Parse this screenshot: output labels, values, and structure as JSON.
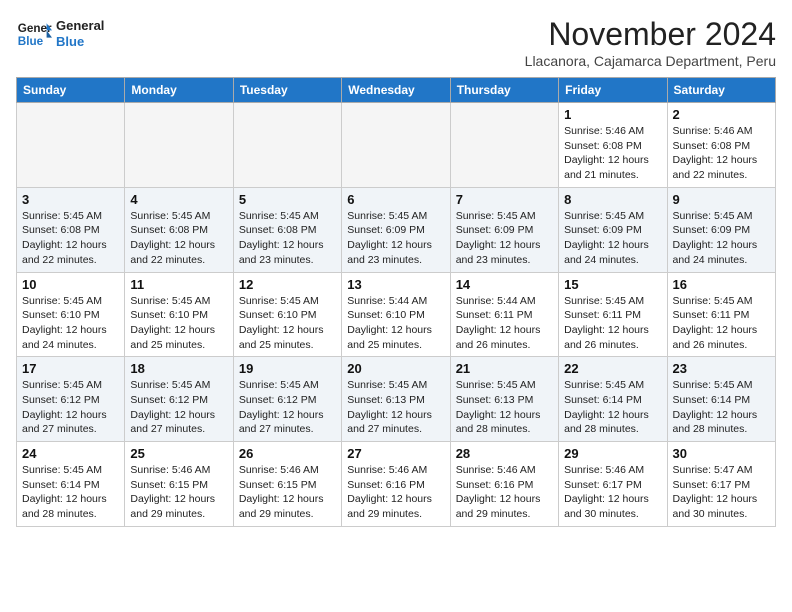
{
  "header": {
    "logo_line1": "General",
    "logo_line2": "Blue",
    "month": "November 2024",
    "location": "Llacanora, Cajamarca Department, Peru"
  },
  "weekdays": [
    "Sunday",
    "Monday",
    "Tuesday",
    "Wednesday",
    "Thursday",
    "Friday",
    "Saturday"
  ],
  "weeks": [
    [
      {
        "day": "",
        "info": ""
      },
      {
        "day": "",
        "info": ""
      },
      {
        "day": "",
        "info": ""
      },
      {
        "day": "",
        "info": ""
      },
      {
        "day": "",
        "info": ""
      },
      {
        "day": "1",
        "info": "Sunrise: 5:46 AM\nSunset: 6:08 PM\nDaylight: 12 hours\nand 21 minutes."
      },
      {
        "day": "2",
        "info": "Sunrise: 5:46 AM\nSunset: 6:08 PM\nDaylight: 12 hours\nand 22 minutes."
      }
    ],
    [
      {
        "day": "3",
        "info": "Sunrise: 5:45 AM\nSunset: 6:08 PM\nDaylight: 12 hours\nand 22 minutes."
      },
      {
        "day": "4",
        "info": "Sunrise: 5:45 AM\nSunset: 6:08 PM\nDaylight: 12 hours\nand 22 minutes."
      },
      {
        "day": "5",
        "info": "Sunrise: 5:45 AM\nSunset: 6:08 PM\nDaylight: 12 hours\nand 23 minutes."
      },
      {
        "day": "6",
        "info": "Sunrise: 5:45 AM\nSunset: 6:09 PM\nDaylight: 12 hours\nand 23 minutes."
      },
      {
        "day": "7",
        "info": "Sunrise: 5:45 AM\nSunset: 6:09 PM\nDaylight: 12 hours\nand 23 minutes."
      },
      {
        "day": "8",
        "info": "Sunrise: 5:45 AM\nSunset: 6:09 PM\nDaylight: 12 hours\nand 24 minutes."
      },
      {
        "day": "9",
        "info": "Sunrise: 5:45 AM\nSunset: 6:09 PM\nDaylight: 12 hours\nand 24 minutes."
      }
    ],
    [
      {
        "day": "10",
        "info": "Sunrise: 5:45 AM\nSunset: 6:10 PM\nDaylight: 12 hours\nand 24 minutes."
      },
      {
        "day": "11",
        "info": "Sunrise: 5:45 AM\nSunset: 6:10 PM\nDaylight: 12 hours\nand 25 minutes."
      },
      {
        "day": "12",
        "info": "Sunrise: 5:45 AM\nSunset: 6:10 PM\nDaylight: 12 hours\nand 25 minutes."
      },
      {
        "day": "13",
        "info": "Sunrise: 5:44 AM\nSunset: 6:10 PM\nDaylight: 12 hours\nand 25 minutes."
      },
      {
        "day": "14",
        "info": "Sunrise: 5:44 AM\nSunset: 6:11 PM\nDaylight: 12 hours\nand 26 minutes."
      },
      {
        "day": "15",
        "info": "Sunrise: 5:45 AM\nSunset: 6:11 PM\nDaylight: 12 hours\nand 26 minutes."
      },
      {
        "day": "16",
        "info": "Sunrise: 5:45 AM\nSunset: 6:11 PM\nDaylight: 12 hours\nand 26 minutes."
      }
    ],
    [
      {
        "day": "17",
        "info": "Sunrise: 5:45 AM\nSunset: 6:12 PM\nDaylight: 12 hours\nand 27 minutes."
      },
      {
        "day": "18",
        "info": "Sunrise: 5:45 AM\nSunset: 6:12 PM\nDaylight: 12 hours\nand 27 minutes."
      },
      {
        "day": "19",
        "info": "Sunrise: 5:45 AM\nSunset: 6:12 PM\nDaylight: 12 hours\nand 27 minutes."
      },
      {
        "day": "20",
        "info": "Sunrise: 5:45 AM\nSunset: 6:13 PM\nDaylight: 12 hours\nand 27 minutes."
      },
      {
        "day": "21",
        "info": "Sunrise: 5:45 AM\nSunset: 6:13 PM\nDaylight: 12 hours\nand 28 minutes."
      },
      {
        "day": "22",
        "info": "Sunrise: 5:45 AM\nSunset: 6:14 PM\nDaylight: 12 hours\nand 28 minutes."
      },
      {
        "day": "23",
        "info": "Sunrise: 5:45 AM\nSunset: 6:14 PM\nDaylight: 12 hours\nand 28 minutes."
      }
    ],
    [
      {
        "day": "24",
        "info": "Sunrise: 5:45 AM\nSunset: 6:14 PM\nDaylight: 12 hours\nand 28 minutes."
      },
      {
        "day": "25",
        "info": "Sunrise: 5:46 AM\nSunset: 6:15 PM\nDaylight: 12 hours\nand 29 minutes."
      },
      {
        "day": "26",
        "info": "Sunrise: 5:46 AM\nSunset: 6:15 PM\nDaylight: 12 hours\nand 29 minutes."
      },
      {
        "day": "27",
        "info": "Sunrise: 5:46 AM\nSunset: 6:16 PM\nDaylight: 12 hours\nand 29 minutes."
      },
      {
        "day": "28",
        "info": "Sunrise: 5:46 AM\nSunset: 6:16 PM\nDaylight: 12 hours\nand 29 minutes."
      },
      {
        "day": "29",
        "info": "Sunrise: 5:46 AM\nSunset: 6:17 PM\nDaylight: 12 hours\nand 30 minutes."
      },
      {
        "day": "30",
        "info": "Sunrise: 5:47 AM\nSunset: 6:17 PM\nDaylight: 12 hours\nand 30 minutes."
      }
    ]
  ]
}
